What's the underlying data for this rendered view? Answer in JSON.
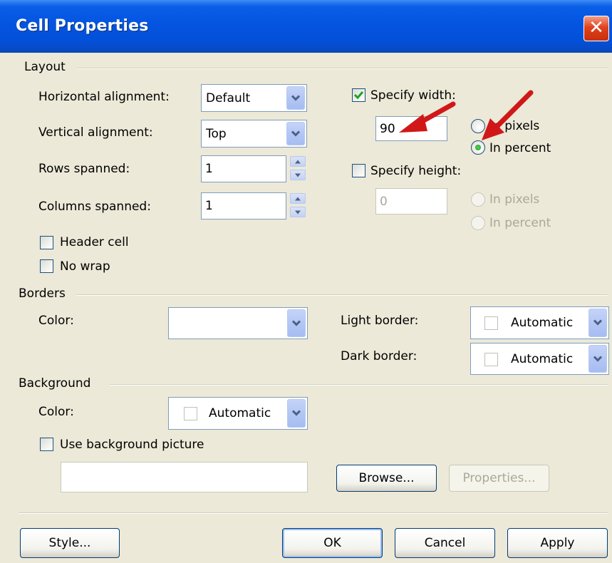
{
  "window": {
    "title": "Cell Properties"
  },
  "layout": {
    "group_label": "Layout",
    "horizontal_alignment": {
      "label": "Horizontal alignment:",
      "value": "Default"
    },
    "vertical_alignment": {
      "label": "Vertical alignment:",
      "value": "Top"
    },
    "rows_spanned": {
      "label": "Rows spanned:",
      "value": "1"
    },
    "columns_spanned": {
      "label": "Columns spanned:",
      "value": "1"
    },
    "header_cell": {
      "label": "Header cell",
      "checked": false
    },
    "no_wrap": {
      "label": "No wrap",
      "checked": false
    },
    "specify_width": {
      "label": "Specify width:",
      "checked": true,
      "value": "90",
      "in_pixels": "In pixels",
      "in_percent": "In percent",
      "selected": "In percent"
    },
    "specify_height": {
      "label": "Specify height:",
      "checked": false,
      "value": "0",
      "in_pixels": "In pixels",
      "in_percent": "In percent"
    }
  },
  "borders": {
    "group_label": "Borders",
    "color_label": "Color:",
    "color_value": "",
    "light_border": {
      "label": "Light border:",
      "value": "Automatic"
    },
    "dark_border": {
      "label": "Dark border:",
      "value": "Automatic"
    }
  },
  "background": {
    "group_label": "Background",
    "color_label": "Color:",
    "color_value": "Automatic",
    "use_picture": {
      "label": "Use background picture",
      "checked": false
    },
    "picture_path": "",
    "browse_label": "Browse...",
    "properties_label": "Properties..."
  },
  "footer": {
    "style_label": "Style...",
    "ok_label": "OK",
    "cancel_label": "Cancel",
    "apply_label": "Apply"
  },
  "colors": {
    "titlebar": "#0454e1",
    "dialog_bg": "#ece9d8",
    "annotation_arrow": "#d01818",
    "checkmark": "#21a121"
  },
  "icons": {
    "close": "close-icon",
    "dropdown": "chevron-down-icon",
    "spinner_up": "spin-up-icon",
    "spinner_down": "spin-down-icon",
    "check": "checkmark-icon"
  }
}
